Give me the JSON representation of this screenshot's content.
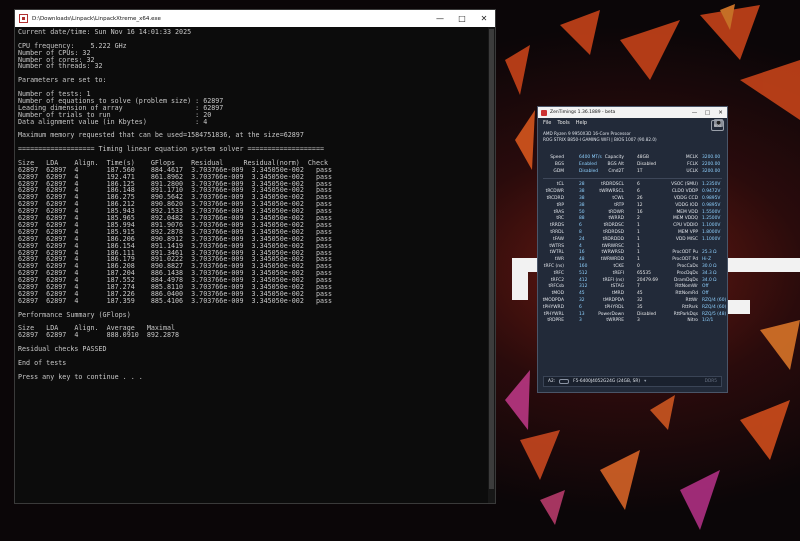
{
  "console": {
    "title": "D:\\Downloads\\Linpack\\LinpackXtreme_x64.exe",
    "lines": [
      "Current date/time: Sun Nov 16 14:01:33 2025",
      "",
      "CPU frequency:    5.222 GHz",
      "Number of CPUs: 32",
      "Number of cores: 32",
      "Number of threads: 32",
      "",
      "Parameters are set to:",
      "",
      "Number of tests: 1",
      "Number of equations to solve (problem size) : 62897",
      "Leading dimension of array                  : 62897",
      "Number of trials to run                     : 20",
      "Data alignment value (in Kbytes)            : 4",
      "",
      "Maximum memory requested that can be used=1584751836, at the size=62897",
      "",
      "=================== Timing linear equation system solver ===================",
      "",
      "Size   LDA    Align.  Time(s)    GFlops    Residual     Residual(norm)  Check",
      "62897  62897  4       187.560    884.4617  3.703766e-009  3.345050e-002   pass",
      "62897  62897  4       192.471    861.8962  3.703766e-009  3.345050e-002   pass",
      "62897  62897  4       186.125    891.2800  3.703766e-009  3.345050e-002   pass",
      "62897  62897  4       186.148    891.1710  3.703766e-009  3.345050e-002   pass",
      "62897  62897  4       186.275    890.5642  3.703766e-009  3.345050e-002   pass",
      "62897  62897  4       186.212    890.8620  3.703766e-009  3.345050e-002   pass",
      "62897  62897  4       185.943    892.1533  3.703766e-009  3.345050e-002   pass",
      "62897  62897  4       185.965    892.0482  3.703766e-009  3.345050e-002   pass",
      "62897  62897  4       185.994    891.9076  3.703766e-009  3.345050e-002   pass",
      "62897  62897  4       185.915    892.2878  3.703766e-009  3.345050e-002   pass",
      "62897  62897  4       186.206    890.8912  3.703766e-009  3.345050e-002   pass",
      "62897  62897  4       186.154    891.1419  3.703766e-009  3.345050e-002   pass",
      "62897  62897  4       186.111    891.3461  3.703766e-009  3.345050e-002   pass",
      "62897  62897  4       186.179    891.0222  3.703766e-009  3.345050e-002   pass",
      "62897  62897  4       186.208    890.8827  3.703766e-009  3.345050e-002   pass",
      "62897  62897  4       187.204    886.1438  3.703766e-009  3.345050e-002   pass",
      "62897  62897  4       187.552    884.4978  3.703766e-009  3.345050e-002   pass",
      "62897  62897  4       187.274    885.8110  3.703766e-009  3.345050e-002   pass",
      "62897  62897  4       187.226    886.0400  3.703766e-009  3.345050e-002   pass",
      "62897  62897  4       187.359    885.4106  3.703766e-009  3.345050e-002   pass",
      "",
      "Performance Summary (GFlops)",
      "",
      "Size   LDA    Align.  Average   Maximal",
      "62897  62897  4       888.0910  892.2878",
      "",
      "Residual checks PASSED",
      "",
      "End of tests",
      "",
      "Press any key to continue . . ."
    ]
  },
  "zentimings": {
    "title": "ZenTimings 1.36.1889 - beta",
    "menu": [
      "File",
      "Tools",
      "Help"
    ],
    "cpu": "AMD Ryzen 9 9950X3D 16-Core Processor",
    "board": "ROG STRIX B850-I GAMING WIFI | BIOS 1007 (90.82.0)",
    "rog_badge": "ROG",
    "top": [
      [
        "Speed",
        "6400 MT/s",
        "Capacity",
        "48GB",
        "MCLK",
        "3200.00"
      ],
      [
        "BGS",
        "Enabled",
        "BGS Alt",
        "Disabled",
        "FCLK",
        "2200.00"
      ],
      [
        "GDM",
        "Disabled",
        "Cmd2T",
        "1T",
        "UCLK",
        "3200.00"
      ]
    ],
    "timings": [
      [
        "tCL",
        "28",
        "tRDRDSCL",
        "6",
        "VSOC (SMU)",
        "1.2350V"
      ],
      [
        "tRCDWR",
        "38",
        "tWRWRSCL",
        "6",
        "CLDO VDDP",
        "0.9472V"
      ],
      [
        "tRCDRD",
        "38",
        "tCWL",
        "26",
        "VDDG CCD",
        "0.9895V"
      ],
      [
        "tRP",
        "38",
        "tRTP",
        "12",
        "VDDG IOD",
        "0.9895V"
      ],
      [
        "tRAS",
        "50",
        "tRDWR",
        "16",
        "MEM VDD",
        "1.5500V"
      ],
      [
        "tRC",
        "88",
        "tWRRD",
        "2",
        "MEM VDDQ",
        "1.2500V"
      ],
      [
        "tRRDS",
        "6",
        "tRDRDSC",
        "1",
        "CPU VDDIO",
        "1.1000V"
      ],
      [
        "tRRDL",
        "8",
        "tRDRDSD",
        "1",
        "MEM VPP",
        "1.8000V"
      ],
      [
        "tFAW",
        "24",
        "tRDRDDD",
        "1",
        "VDD MISC",
        "1.1000V"
      ],
      [
        "tWTRS",
        "4",
        "tWRWRSC",
        "1",
        "",
        ""
      ],
      [
        "tWTRL",
        "16",
        "tWRWRSD",
        "1",
        "ProcODT Pu",
        "25.3 Ω"
      ],
      [
        "tWR",
        "48",
        "tWRWRDD",
        "1",
        "ProcODT Pd",
        "Hi-Z"
      ],
      [
        "tRFC (ns)",
        "160",
        "tCKE",
        "0",
        "ProcCaDs",
        "30.0 Ω"
      ],
      [
        "tRFC",
        "512",
        "tREFI",
        "65535",
        "ProcDqDs",
        "34.3 Ω"
      ],
      [
        "tRFC2",
        "412",
        "tREFI (ns)",
        "20479.69",
        "DramDqDs",
        "34.0 Ω"
      ],
      [
        "tRFCsb",
        "312",
        "tSTAG",
        "7",
        "RttNomWr",
        "Off"
      ],
      [
        "tMOD",
        "45",
        "tMRD",
        "45",
        "RttNomRd",
        "Off"
      ],
      [
        "tMODPDA",
        "32",
        "tMRDPDA",
        "32",
        "RttWr",
        "RZQ/4 (60)"
      ],
      [
        "tPHYWRD",
        "6",
        "tPHYRDL",
        "35",
        "RttPark",
        "RZQ/4 (60)"
      ],
      [
        "tPHYWRL",
        "13",
        "PowerDown",
        "Disabled",
        "RttParkDqs",
        "RZQ/5 (48)"
      ],
      [
        "tRDPRE",
        "3",
        "tWRPRE",
        "3",
        "Nitro",
        "1/2/1"
      ]
    ],
    "dimm_slot": "A2:",
    "dimm_text": "F5-6400J4052G24G (24GB, SR)",
    "dimm_type": "DDR5"
  }
}
